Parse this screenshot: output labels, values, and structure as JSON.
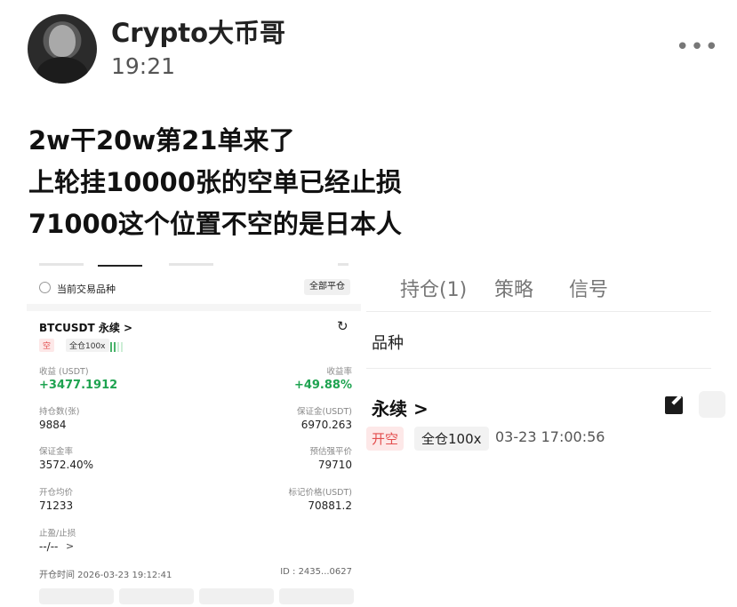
{
  "post": {
    "author": "Crypto大币哥",
    "time": "19:21",
    "more": "•••",
    "lines": [
      "2w干20w第21单来了",
      "上轮挂10000张的空单已经止损",
      "71000这个位置不空的是日本人"
    ]
  },
  "left_screenshot": {
    "current_symbol_label": "当前交易品种",
    "close_all_button": "全部平仓",
    "symbol": "BTCUSDT 永续 >",
    "share_icon": "↻",
    "tag_short": "空",
    "tag_cross": "全仓100x",
    "pnl_label": "收益 (USDT)",
    "pnl_value": "+3477.1912",
    "roe_label": "收益率",
    "roe_value": "+49.88%",
    "size_label": "持仓数(张)",
    "size_value": "9884",
    "margin_label": "保证金(USDT)",
    "margin_value": "6970.263",
    "margin_ratio_label": "保证金率",
    "margin_ratio_value": "3572.40%",
    "liq_label": "预估强平价",
    "liq_value": "79710",
    "entry_label": "开仓均价",
    "entry_value": "71233",
    "mark_label": "标记价格(USDT)",
    "mark_value": "70881.2",
    "tpsl_label": "止盈/止损",
    "tpsl_value": "--/--",
    "tpsl_chevron": ">",
    "open_time": "开仓时间 2026-03-23 19:12:41",
    "id_text": "ID : 2435...0627"
  },
  "right_screenshot": {
    "tabs": [
      "持仓(1)",
      "策略",
      "信号"
    ],
    "heading": "品种",
    "symbol": "永续 >",
    "tag_open": "开空",
    "tag_cross": "全仓100x",
    "date": "03-23 17:00:56"
  },
  "colors": {
    "profit_green": "#1ea350",
    "short_red": "#e34d4d"
  }
}
